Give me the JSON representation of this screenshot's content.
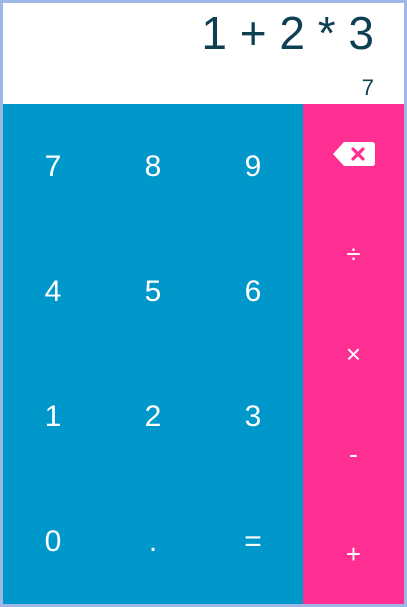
{
  "display": {
    "expression": "1 + 2 * 3",
    "result": "7"
  },
  "numpad": {
    "rows": [
      [
        "7",
        "8",
        "9"
      ],
      [
        "4",
        "5",
        "6"
      ],
      [
        "1",
        "2",
        "3"
      ],
      [
        "0",
        ".",
        "="
      ]
    ]
  },
  "operators": {
    "backspace_icon": "backspace-icon",
    "divide": "÷",
    "multiply": "×",
    "subtract": "-",
    "add": "+"
  },
  "colors": {
    "numpad_bg": "#0097cb",
    "operator_bg": "#ff2e93",
    "display_text": "#0e3f52",
    "frame_border": "#9fb7e6"
  }
}
